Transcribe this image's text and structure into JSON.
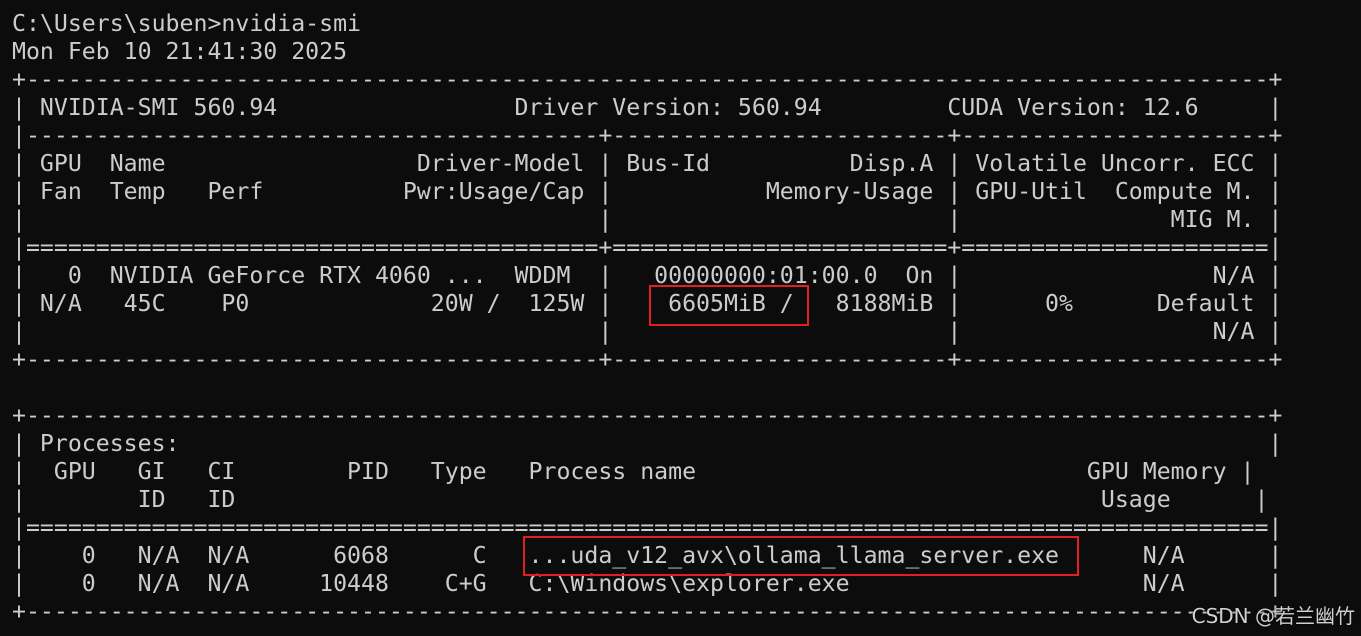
{
  "terminal": {
    "lines": [
      "C:\\Users\\suben>nvidia-smi",
      "Mon Feb 10 21:41:30 2025",
      "+-----------------------------------------------------------------------------------------+",
      "| NVIDIA-SMI 560.94                 Driver Version: 560.94         CUDA Version: 12.6     |",
      "|-----------------------------------------+------------------------+----------------------+",
      "| GPU  Name                  Driver-Model | Bus-Id          Disp.A | Volatile Uncorr. ECC |",
      "| Fan  Temp   Perf          Pwr:Usage/Cap |           Memory-Usage | GPU-Util  Compute M. |",
      "|                                         |                        |               MIG M. |",
      "|=========================================+========================+======================|",
      "|   0  NVIDIA GeForce RTX 4060 ...  WDDM  |   00000000:01:00.0  On |                  N/A |",
      "| N/A   45C    P0             20W /  125W |    6605MiB /   8188MiB |      0%      Default |",
      "|                                         |                        |                  N/A |",
      "+-----------------------------------------+------------------------+----------------------+",
      "",
      "+-----------------------------------------------------------------------------------------+",
      "| Processes:                                                                              |",
      "|  GPU   GI   CI        PID   Type   Process name                            GPU Memory |",
      "|        ID   ID                                                              Usage      |",
      "|=========================================================================================|",
      "|    0   N/A  N/A      6068      C   ...uda_v12_avx\\ollama_llama_server.exe      N/A      |",
      "|    0   N/A  N/A     10448    C+G   C:\\Windows\\explorer.exe                     N/A      |",
      "+-----------------------------------------------------------------------------------------+"
    ]
  },
  "highlights": {
    "memory_usage": "6605MiB /",
    "process_name": "...uda_v12_avx\\ollama_llama_server.exe",
    "color": "#e02020"
  },
  "watermark": "CSDN @若兰幽竹",
  "colors": {
    "background": "#0c0c0c",
    "text": "#cccccc"
  }
}
